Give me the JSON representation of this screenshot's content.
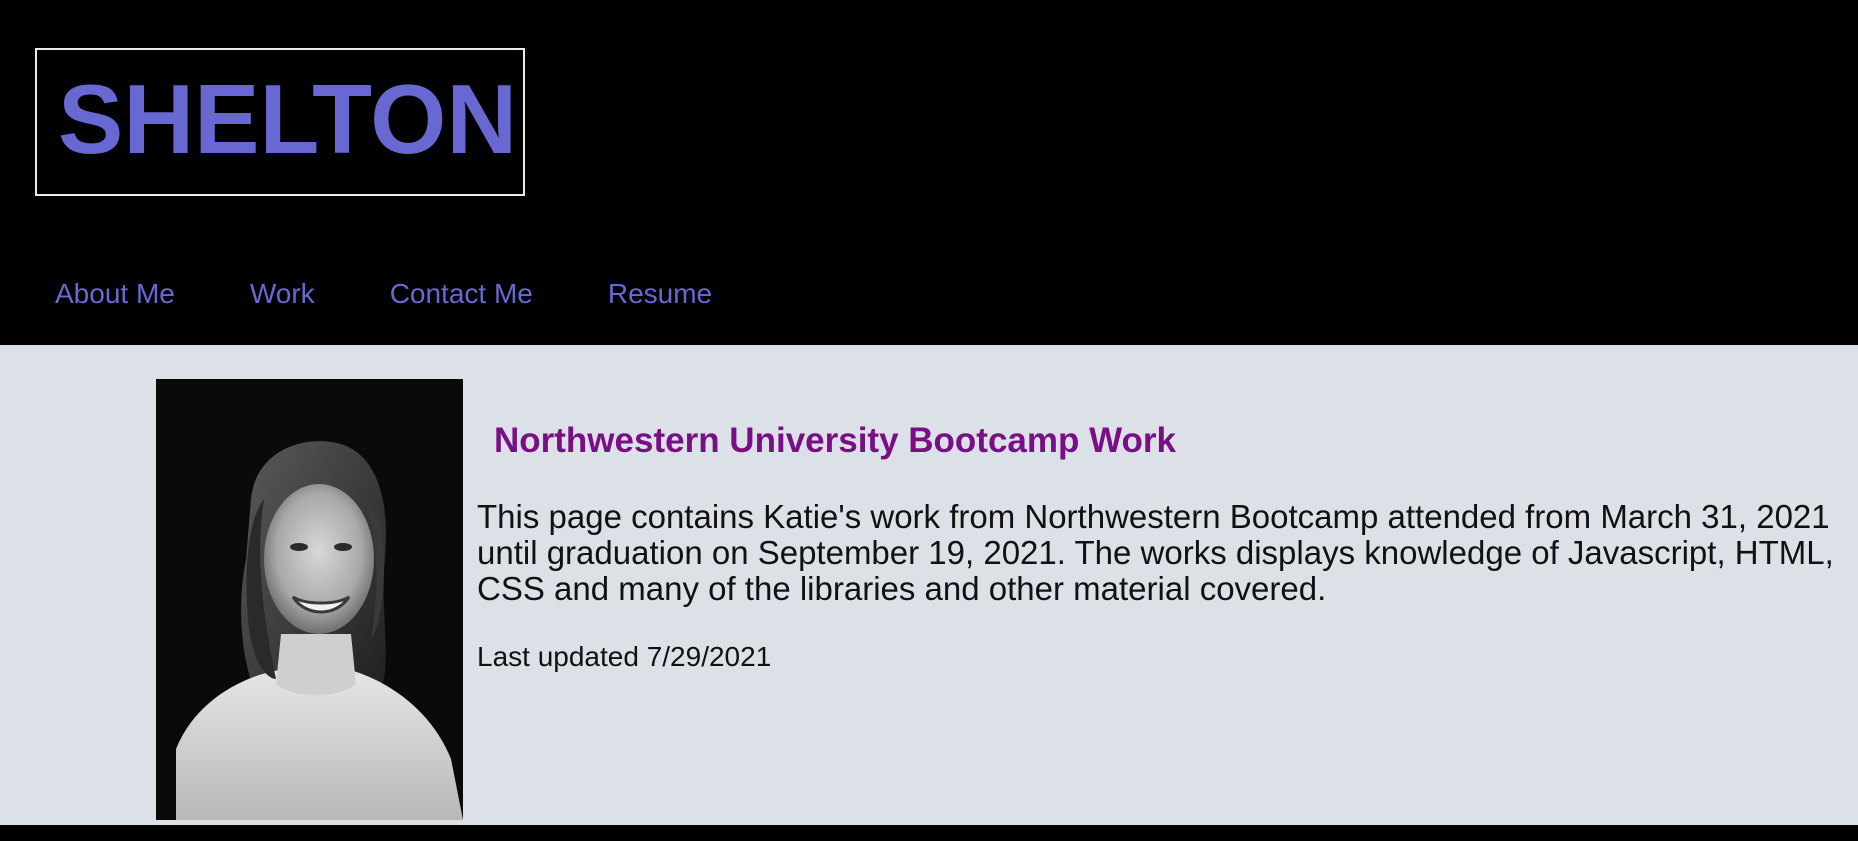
{
  "header": {
    "logo": "SHELTON",
    "nav": [
      {
        "label": "About Me"
      },
      {
        "label": "Work"
      },
      {
        "label": "Contact Me"
      },
      {
        "label": "Resume"
      }
    ]
  },
  "main": {
    "photo_alt": "portrait photo",
    "title": "Northwestern University Bootcamp Work",
    "description": "This page contains Katie's work from Northwestern Bootcamp attended from March 31, 2021 until graduation on September 19, 2021. The works displays knowledge of Javascript, HTML, CSS and many of the libraries and other material covered.",
    "last_updated": "Last updated 7/29/2021"
  },
  "colors": {
    "accent": "#6868d2",
    "title": "#7a0e86",
    "header_bg": "#000000",
    "main_bg": "#dce0e7"
  }
}
